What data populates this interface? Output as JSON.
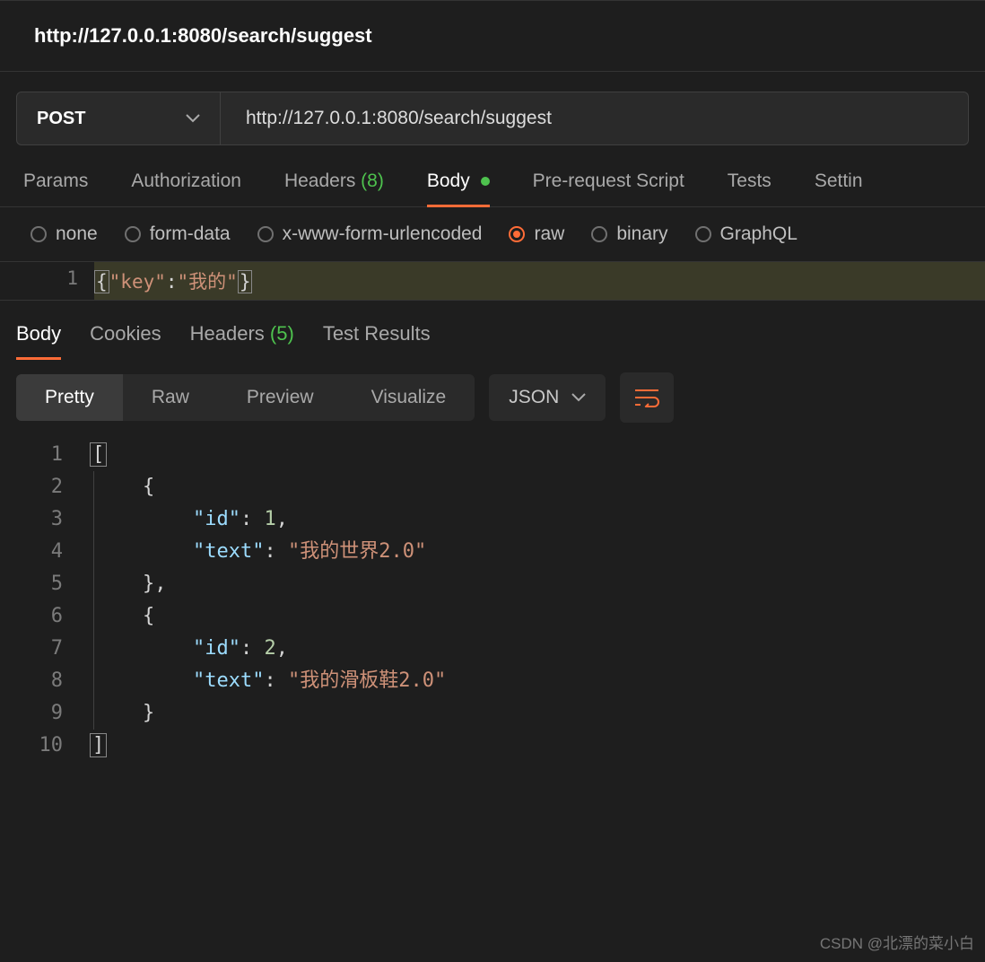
{
  "title": "http://127.0.0.1:8080/search/suggest",
  "method": "POST",
  "url": "http://127.0.0.1:8080/search/suggest",
  "tabs": {
    "params": "Params",
    "authorization": "Authorization",
    "headers_label": "Headers",
    "headers_count": "(8)",
    "body": "Body",
    "prerequest": "Pre-request Script",
    "tests": "Tests",
    "settings": "Settin"
  },
  "body_types": {
    "none": "none",
    "formdata": "form-data",
    "urlencoded": "x-www-form-urlencoded",
    "raw": "raw",
    "binary": "binary",
    "graphql": "GraphQL"
  },
  "request_body": {
    "line_number": "1",
    "key_token": "\"key\"",
    "val_token": "\"我的\""
  },
  "response_tabs": {
    "body": "Body",
    "cookies": "Cookies",
    "headers_label": "Headers",
    "headers_count": "(5)",
    "test_results": "Test Results"
  },
  "view_tabs": {
    "pretty": "Pretty",
    "raw": "Raw",
    "preview": "Preview",
    "visualize": "Visualize"
  },
  "format": "JSON",
  "response_lines": [
    "1",
    "2",
    "3",
    "4",
    "5",
    "6",
    "7",
    "8",
    "9",
    "10"
  ],
  "response_tokens": {
    "id_key": "\"id\"",
    "text_key": "\"text\"",
    "id1": "1",
    "text1": "\"我的世界2.0\"",
    "id2": "2",
    "text2": "\"我的滑板鞋2.0\""
  },
  "watermark": "CSDN @北漂的菜小白"
}
